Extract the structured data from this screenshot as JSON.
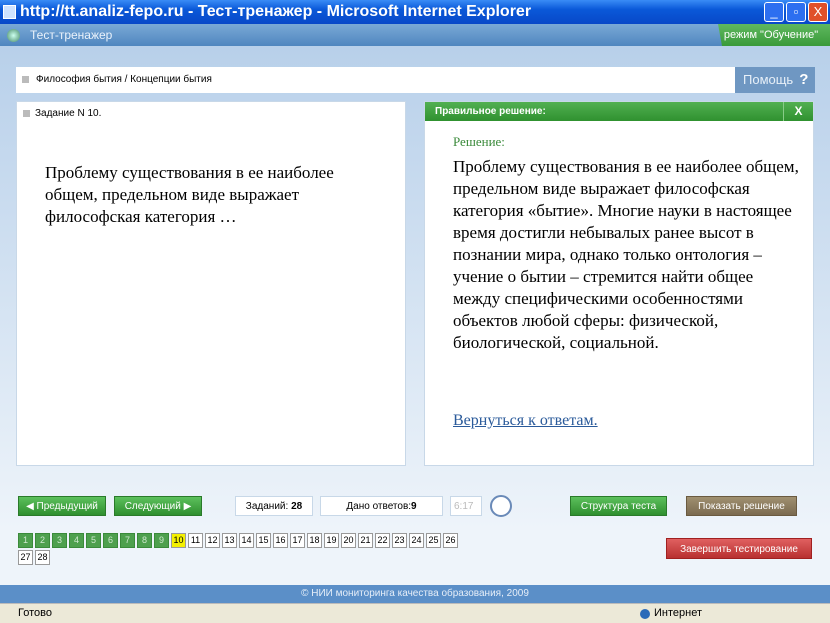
{
  "window": {
    "title": "http://tt.analiz-fepo.ru - Тест-тренажер - Microsoft Internet Explorer",
    "minimize": "_",
    "maximize": "▫",
    "close": "X"
  },
  "app": {
    "title": "Тест-тренажер",
    "mode": "режим \"Обучение\""
  },
  "breadcrumb": "Философия бытия / Концепции бытия",
  "help": {
    "label": "Помощь",
    "icon": "?"
  },
  "task": {
    "header": "Задание N 10.",
    "question": "Проблему существования в ее наиболее общем, предельном виде выражает философская категория …"
  },
  "solution": {
    "header": "Правильное решение:",
    "close": "X",
    "label": "Решение:",
    "text": "Проблему существования в ее наиболее общем, предельном виде выражает философская категория «бытие». Многие науки в настоящее время достигли небывалых ранее высот в познании мира, однако только онтология – учение о бытии – стремится найти общее между специфическими особенностями объектов любой сферы: физической, биологической, социальной.",
    "back_link": "Вернуться к ответам."
  },
  "nav": {
    "prev": "◀ Предыдущий",
    "next": "Следующий ▶",
    "tasks_label": "Заданий:",
    "tasks_count": "28",
    "answers_label": "Дано ответов:",
    "answers_count": "9",
    "timer": "6:17",
    "structure": "Структура теста",
    "show_solution": "Показать решение",
    "finish": "Завершить тестирование"
  },
  "pages": [
    "1",
    "2",
    "3",
    "4",
    "5",
    "6",
    "7",
    "8",
    "9",
    "10",
    "11",
    "12",
    "13",
    "14",
    "15",
    "16",
    "17",
    "18",
    "19",
    "20",
    "21",
    "22",
    "23",
    "24",
    "25",
    "26",
    "27",
    "28"
  ],
  "answered_count": 9,
  "current_page": 10,
  "footer": "© НИИ мониторинга качества образования, 2009",
  "status": {
    "left": "Готово",
    "zone": "Интернет"
  }
}
